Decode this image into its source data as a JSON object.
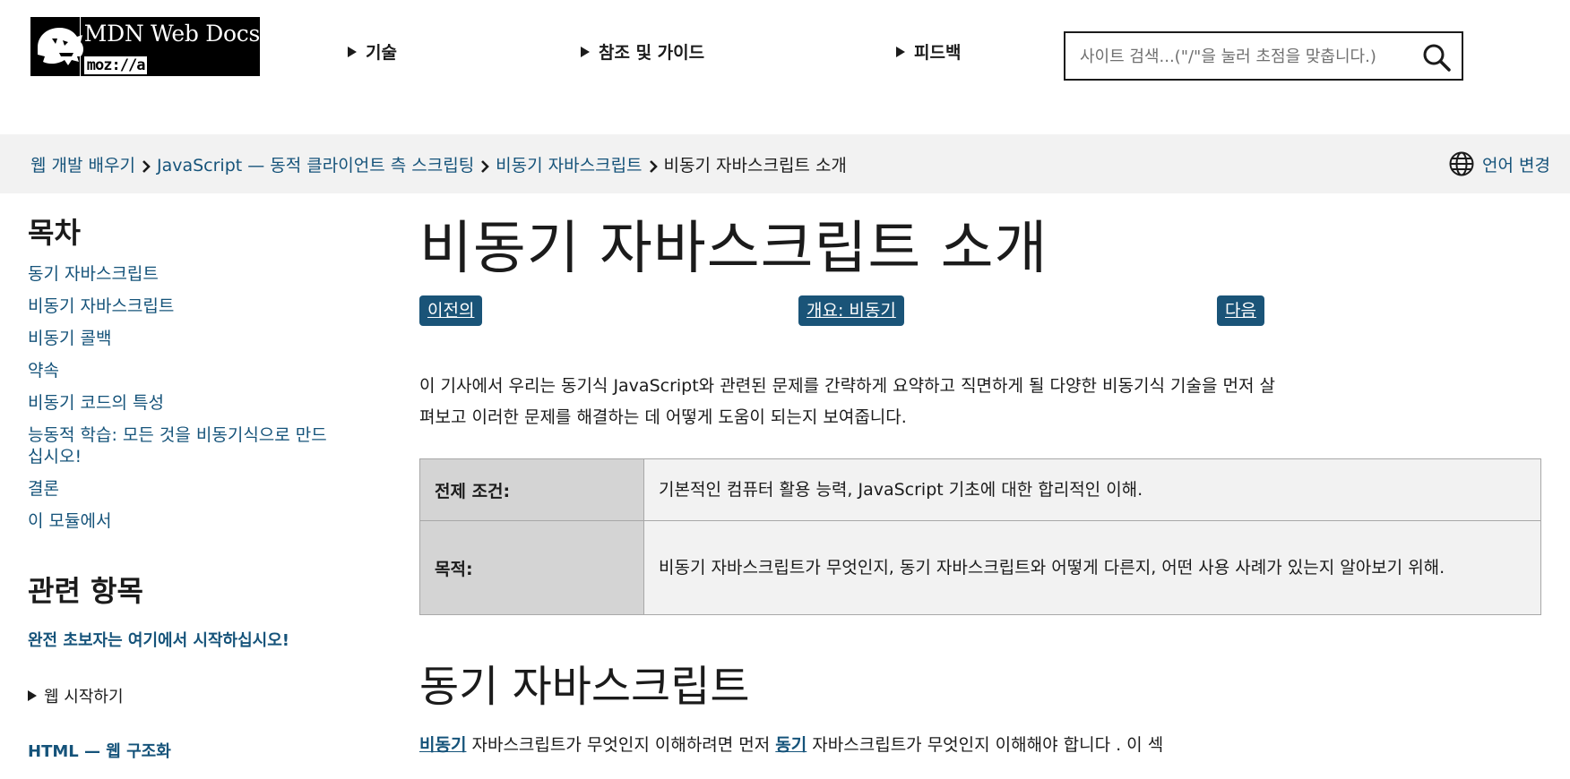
{
  "header": {
    "logo": {
      "title": "MDN Web Docs",
      "moz": "moz://a"
    },
    "nav": [
      {
        "label": "기술"
      },
      {
        "label": "참조 및 가이드"
      },
      {
        "label": "피드백"
      }
    ],
    "search": {
      "placeholder": "사이트 검색...(\"/\"을 눌러 초점을 맞춥니다.)",
      "value": ""
    }
  },
  "breadcrumb": {
    "items": [
      {
        "label": "웹 개발 배우기"
      },
      {
        "label": "JavaScript — 동적 클라이언트 측 스크립팅"
      },
      {
        "label": "비동기 자바스크립트"
      }
    ],
    "current": "비동기 자바스크립트 소개",
    "language_label": "언어 변경"
  },
  "sidebar": {
    "toc_title": "목차",
    "toc": [
      {
        "label": "동기 자바스크립트"
      },
      {
        "label": "비동기 자바스크립트"
      },
      {
        "label": "비동기 콜백"
      },
      {
        "label": "약속"
      },
      {
        "label": "비동기 코드의 특성"
      },
      {
        "label": "능동적 학습: 모든 것을 비동기식으로 만드십시오!"
      },
      {
        "label": "결론"
      },
      {
        "label": "이 모듈에서"
      }
    ],
    "related_title": "관련 항목",
    "related_beginner": "완전 초보자는 여기에서 시작하십시오!",
    "related_details": "웹 시작하기",
    "related_html": "HTML — 웹 구조화"
  },
  "main": {
    "title": "비동기 자바스크립트 소개",
    "pager": {
      "prev": "이전의",
      "overview": "개요: 비동기",
      "next": "다음"
    },
    "intro": "이 기사에서 우리는 동기식 JavaScript와 관련된 문제를 간략하게 요약하고 직면하게 될 다양한 비동기식 기술을 먼저 살펴보고 이러한 문제를 해결하는 데 어떻게 도움이 되는지 보여줍니다.",
    "table": {
      "prereq_label": "전제 조건:",
      "prereq_value": "기본적인 컴퓨터 활용 능력, JavaScript 기초에 대한 합리적인 이해.",
      "objective_label": "목적:",
      "objective_value": "비동기 자바스크립트가 무엇인지, 동기 자바스크립트와 어떻게 다른지, 어떤 사용 사례가 있는지 알아보기 위해."
    },
    "section_title": "동기 자바스크립트",
    "section_para": {
      "link1": "비동기",
      "text1": " 자바스크립트가 무엇인지 이해하려면 먼저 ",
      "link2": "동기",
      "text2": " 자바스크립트가 무엇인지 이해해야 합니다 . 이 섹"
    }
  }
}
